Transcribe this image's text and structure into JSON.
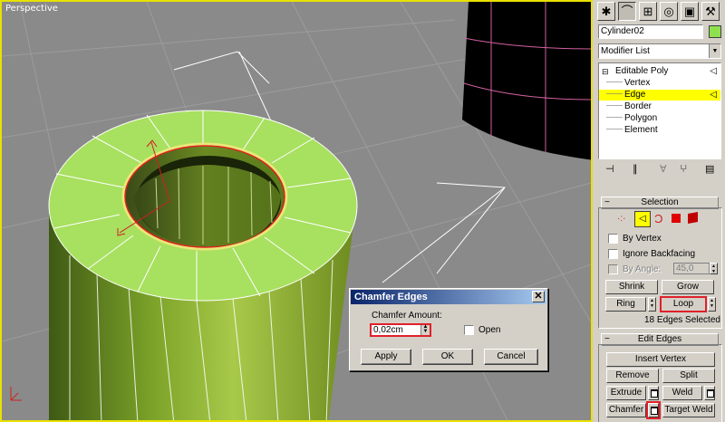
{
  "viewport": {
    "label": "Perspective"
  },
  "dialog": {
    "title": "Chamfer Edges",
    "chamfer_amount_label": "Chamfer Amount:",
    "chamfer_amount_value": "0,02cm",
    "open_label": "Open",
    "apply_label": "Apply",
    "ok_label": "OK",
    "cancel_label": "Cancel"
  },
  "panel": {
    "tabs": [
      "create-tab-icon",
      "modify-tab-icon",
      "hierarchy-tab-icon",
      "motion-tab-icon",
      "display-tab-icon",
      "utilities-tab-icon"
    ],
    "object_name": "Cylinder02",
    "object_color": "#8ee04e",
    "modifier_list": "Modifier List",
    "stack": {
      "root": "Editable Poly",
      "children": [
        "Vertex",
        "Edge",
        "Border",
        "Polygon",
        "Element"
      ],
      "selected": "Edge"
    },
    "selection": {
      "title": "Selection",
      "by_vertex": "By Vertex",
      "ignore_backfacing": "Ignore Backfacing",
      "by_angle": "By Angle:",
      "angle_value": "45,0",
      "shrink": "Shrink",
      "grow": "Grow",
      "ring": "Ring",
      "loop": "Loop",
      "status": "18 Edges Selected"
    },
    "edit_edges": {
      "title": "Edit Edges",
      "insert_vertex": "Insert Vertex",
      "remove": "Remove",
      "split": "Split",
      "extrude": "Extrude",
      "weld": "Weld",
      "chamfer": "Chamfer",
      "target_weld": "Target Weld"
    }
  },
  "colors": {
    "highlight": "#ffff00",
    "callout_red": "#e0202a",
    "object_green": "#8ee04e"
  }
}
